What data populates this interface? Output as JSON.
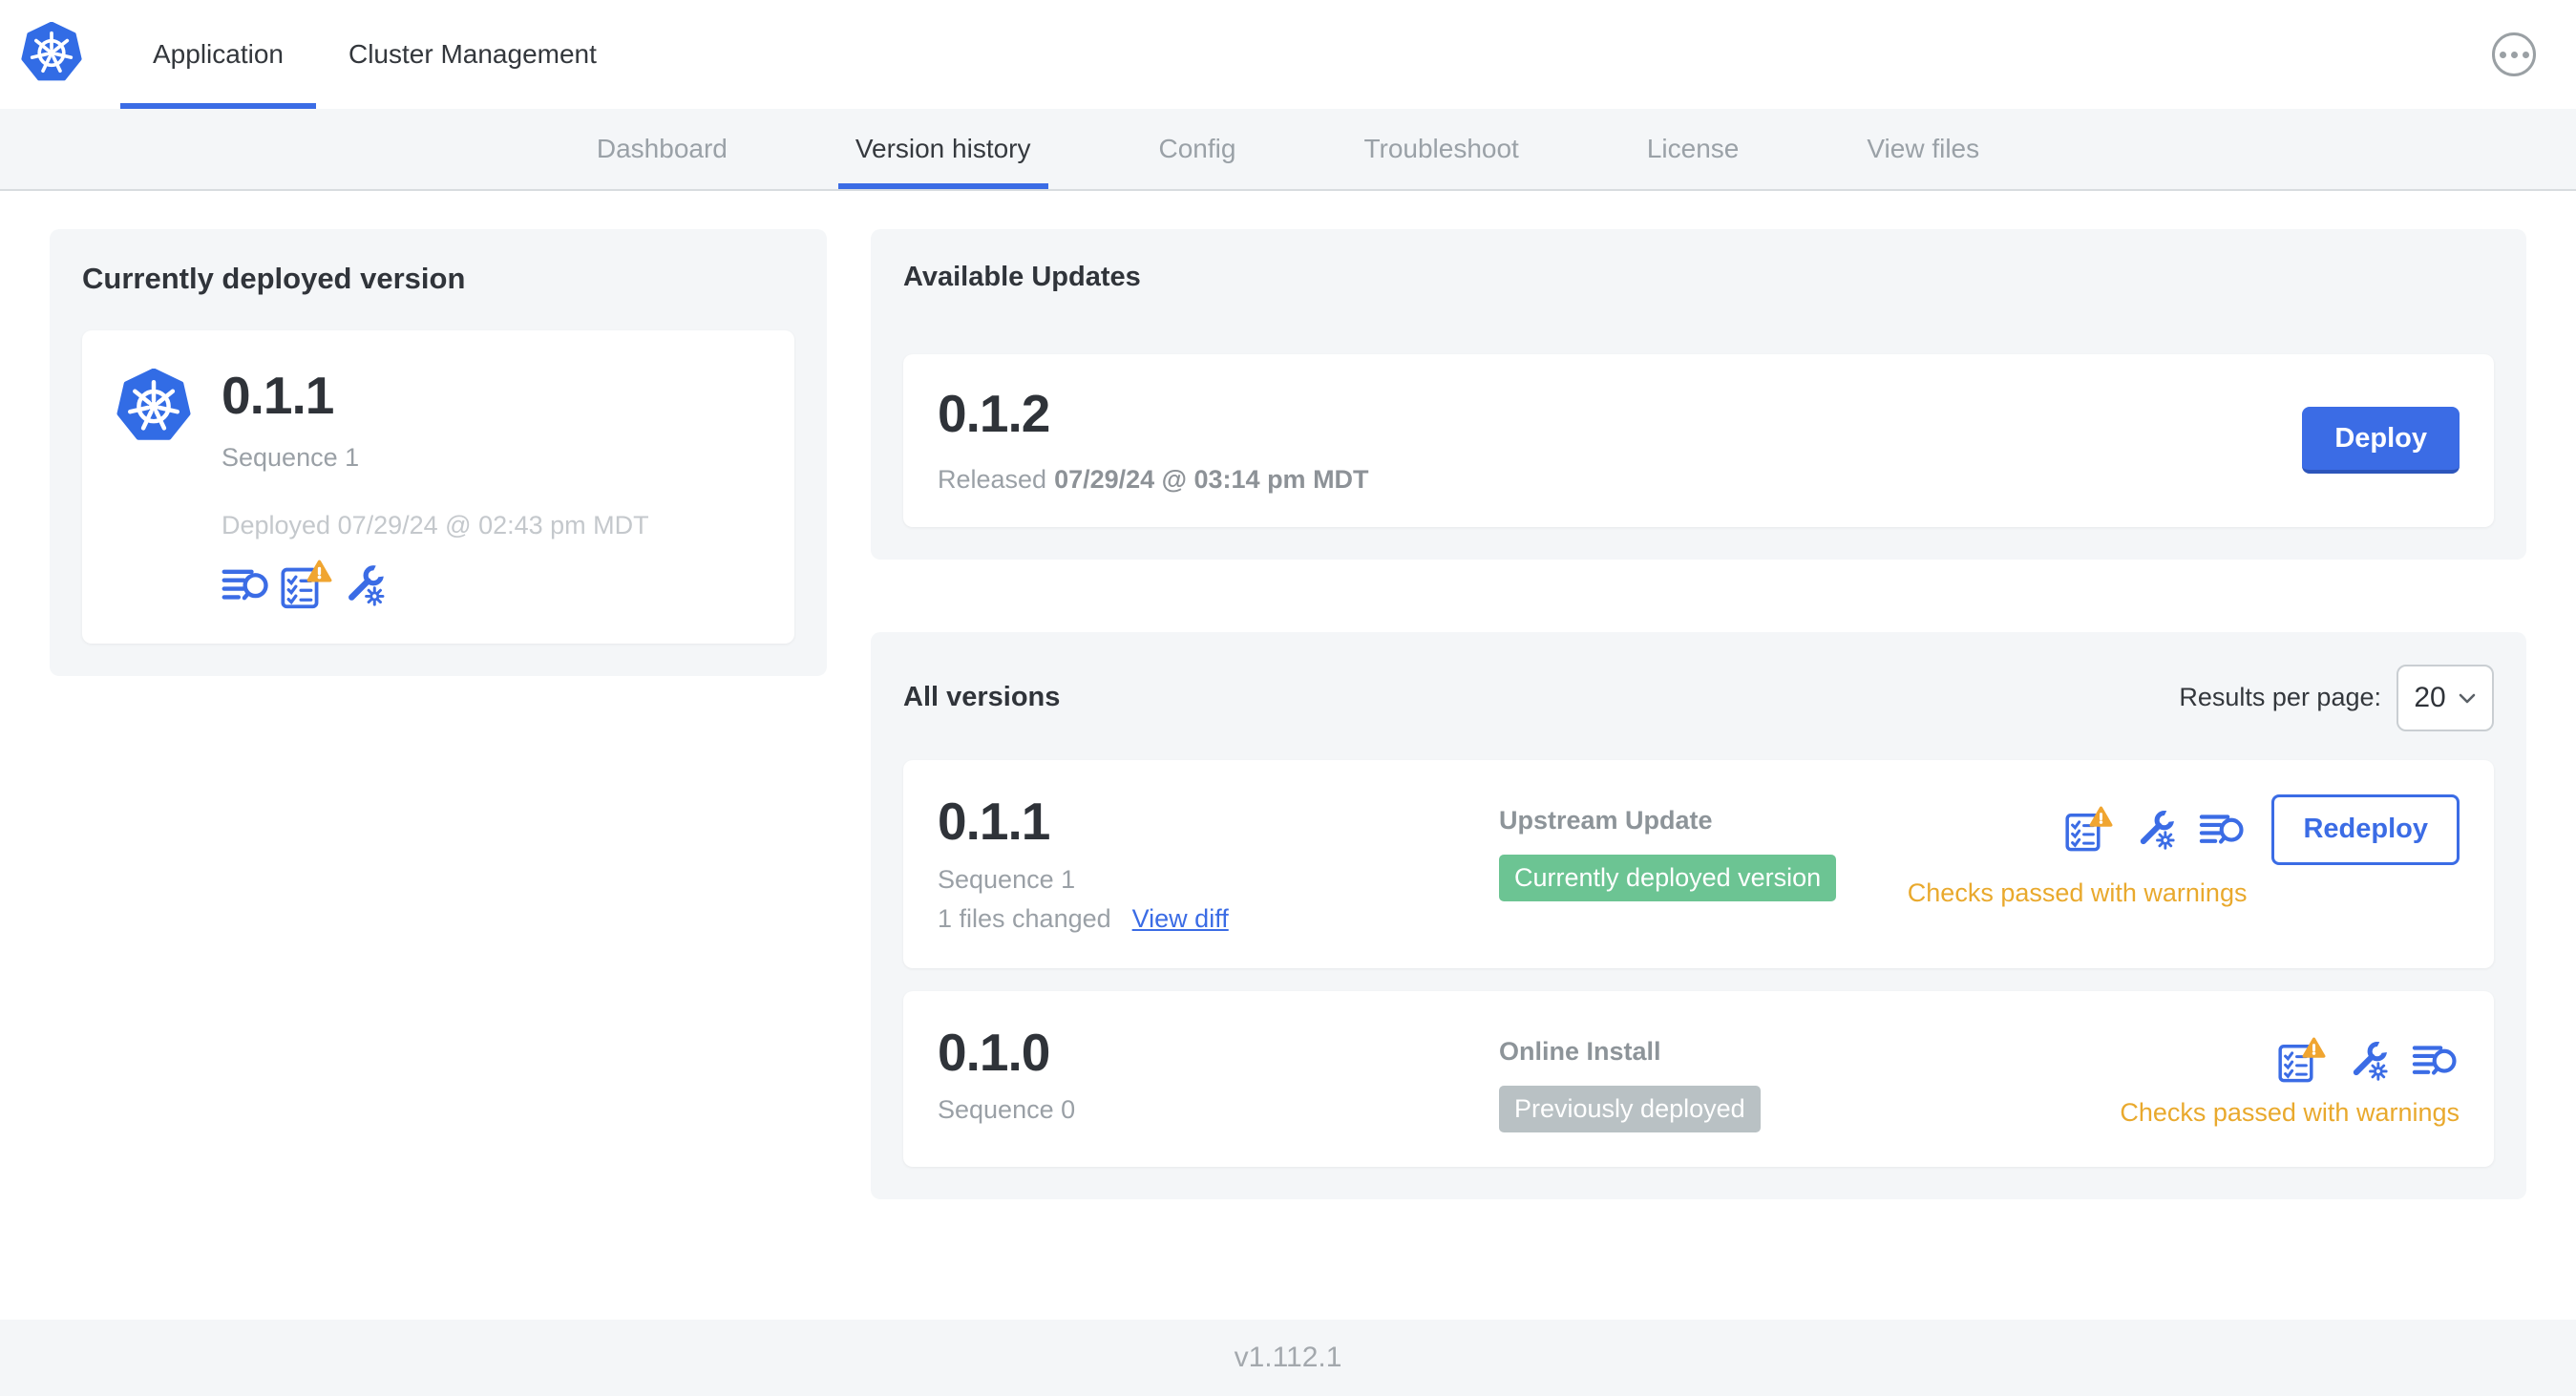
{
  "topnav": {
    "tabs": [
      {
        "label": "Application",
        "active": true
      },
      {
        "label": "Cluster Management",
        "active": false
      }
    ]
  },
  "subnav": {
    "tabs": [
      {
        "label": "Dashboard",
        "active": false
      },
      {
        "label": "Version history",
        "active": true
      },
      {
        "label": "Config",
        "active": false
      },
      {
        "label": "Troubleshoot",
        "active": false
      },
      {
        "label": "License",
        "active": false
      },
      {
        "label": "View files",
        "active": false
      }
    ]
  },
  "current": {
    "title": "Currently deployed version",
    "version": "0.1.1",
    "sequence": "Sequence 1",
    "deployed_at": "Deployed 07/29/24 @ 02:43 pm MDT"
  },
  "updates": {
    "title": "Available Updates",
    "version": "0.1.2",
    "released_label": "Released",
    "released_at": "07/29/24 @ 03:14 pm MDT",
    "deploy_label": "Deploy"
  },
  "versions": {
    "title": "All versions",
    "results_label": "Results per page:",
    "results_value": "20",
    "rows": [
      {
        "version": "0.1.1",
        "sequence": "Sequence 1",
        "files_changed": "1 files changed",
        "view_diff_label": "View diff",
        "source": "Upstream Update",
        "badge": "Currently deployed version",
        "badge_type": "green",
        "status": "Checks passed with warnings",
        "action_label": "Redeploy"
      },
      {
        "version": "0.1.0",
        "sequence": "Sequence 0",
        "source": "Online Install",
        "badge": "Previously deployed",
        "badge_type": "gray",
        "status": "Checks passed with warnings"
      }
    ]
  },
  "footer": {
    "app_version": "v1.112.1"
  },
  "icons": {
    "nav_logo": "kubernetes-logo",
    "menu": "ellipsis",
    "version_icons": [
      "diff-search",
      "preflight-checklist-warning",
      "config-wrench-gear"
    ],
    "select_chevron": "chevron-down",
    "warning_overlay": "warning-triangle"
  },
  "colors": {
    "accent_blue": "#3b6ce5",
    "k8s_blue": "#326ce5",
    "badge_green": "#6cc493",
    "badge_gray": "#b9c1c4",
    "warning_amber": "#e9a92d",
    "warning_triangle": "#f0a530",
    "panel_gray": "#f4f6f8"
  }
}
